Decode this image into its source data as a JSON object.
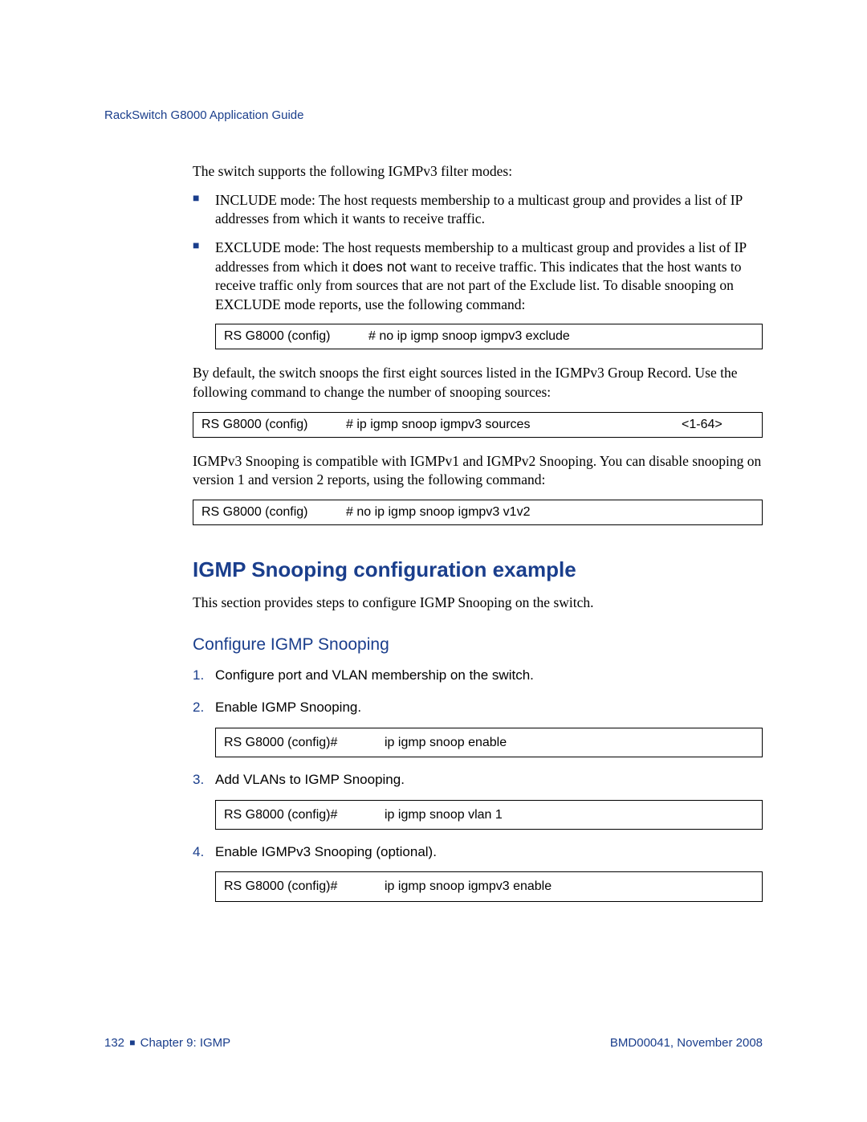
{
  "header": {
    "title": "RackSwitch G8000  Application Guide"
  },
  "intro": "The switch supports the following IGMPv3 filter modes:",
  "bullets": [
    {
      "text_html": "INCLUDE mode: The host requests membership to a multicast group and provides a list of IP addresses from which it wants to receive traffic."
    },
    {
      "text_html": "EXCLUDE mode: The host requests membership to a multicast group and provides a list of IP addresses from which it <span class=\"no-emph\">does not</span> want to receive traffic. This indicates that the host wants to receive traffic only from sources that are not part of the Exclude list. To disable snooping on EXCLUDE mode reports, use the following command:"
    }
  ],
  "cmd1": {
    "prompt": "RS G8000 (config)",
    "cmd": "# no ip igmp snoop igmpv3 exclude"
  },
  "para2": "By default, the switch snoops the first eight sources listed in the IGMPv3 Group Record. Use the following command to change the number of snooping sources:",
  "cmd2": {
    "prompt": "RS G8000 (config)",
    "cmd": "# ip igmp snoop igmpv3 sources",
    "arg": "<1-64>"
  },
  "para3": "IGMPv3 Snooping is compatible with IGMPv1 and IGMPv2 Snooping. You can disable snooping on version 1 and version 2 reports, using the following command:",
  "cmd3": {
    "prompt": "RS G8000 (config)",
    "cmd": "# no ip igmp snoop igmpv3 v1v2"
  },
  "section": {
    "title": "IGMP Snooping configuration example",
    "intro": "This section provides steps to configure IGMP Snooping on the switch."
  },
  "subsection": {
    "title": "Configure IGMP Snooping"
  },
  "steps": [
    {
      "label": "Configure port and VLAN membership on the switch."
    },
    {
      "label": "Enable IGMP Snooping.",
      "cmd": {
        "prompt": "RS G8000 (config)#",
        "cmd": "ip igmp snoop enable"
      }
    },
    {
      "label": "Add VLANs to IGMP Snooping.",
      "cmd": {
        "prompt": "RS G8000 (config)#",
        "cmd": "ip igmp snoop vlan 1"
      }
    },
    {
      "label": "Enable IGMPv3 Snooping (optional).",
      "cmd": {
        "prompt": "RS G8000 (config)#",
        "cmd": "ip igmp snoop igmpv3 enable"
      }
    }
  ],
  "footer": {
    "page": "132",
    "chapter": "Chapter 9:  IGMP",
    "docid": "BMD00041, November 2008"
  }
}
